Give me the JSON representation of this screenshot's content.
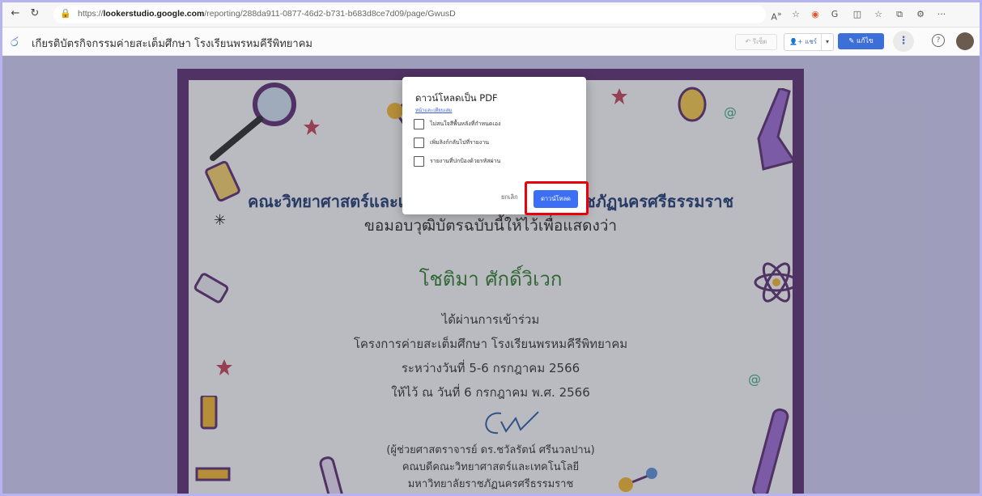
{
  "browser": {
    "url_prefix": "https://",
    "url_host": "lookerstudio.google.com",
    "url_path": "/reporting/288da911-0877-46d2-b731-b683d8ce7d09/page/GwusD",
    "icons": [
      "back-icon",
      "refresh-icon",
      "lock-icon",
      "read-aloud-icon",
      "favorite-icon",
      "extension-icon",
      "extension-icon",
      "split-screen-icon",
      "favorites-icon",
      "collections-icon",
      "copilot-icon",
      "more-icon"
    ]
  },
  "header": {
    "report_title": "เกียรติบัตรกิจกรรมค่ายสะเต็มศึกษา โรงเรียนพรหมคีรีพิทยาคม",
    "reset_label": "↶ รีเซ็ต",
    "share_label": "แชร์",
    "edit_label": "แก้ไข"
  },
  "certificate": {
    "faculty": "คณะวิทยาศาสตร์และเทคโนโลยี มหาวิทยาลัยราชภัฏนครศรีธรรมราช",
    "presents": "ขอมอบวุฒิบัตรฉบับนี้ให้ไว้เพื่อแสดงว่า",
    "name": "โชติมา    ศักดิ์วิเวก",
    "passed": "ได้ผ่านการเข้าร่วม",
    "project": "โครงการค่ายสะเต็มศึกษา โรงเรียนพรหมคีรีพิทยาคม",
    "dates": "ระหว่างวันที่ 5-6 กรกฎาคม 2566",
    "given": "ให้ไว้ ณ วันที่ 6 กรกฎาคม พ.ศ. 2566",
    "sign_name": "(ผู้ช่วยศาสตราจารย์ ดร.ชวัลรัตน์ ศรีนวลปาน)",
    "sign_role": "คณบดีคณะวิทยาศาสตร์และเทคโนโลยี",
    "sign_univ": "มหาวิทยาลัยราชภัฏนครศรีธรรมราช"
  },
  "dialog": {
    "title": "ดาวน์โหลดเป็น PDF",
    "link": "หน้าและเทียบเล่ม",
    "options": [
      {
        "label": "ไม่สนใจสีพื้นหลังที่กำหนดเอง",
        "checked": false
      },
      {
        "label": "เพิ่มลิงก์กลับไปที่รายงาน",
        "checked": false
      },
      {
        "label": "รายงานที่ปกป้องด้วยรหัสผ่าน",
        "checked": false
      }
    ],
    "cancel_label": "ยกเลิก",
    "download_label": "ดาวน์โหลด"
  }
}
